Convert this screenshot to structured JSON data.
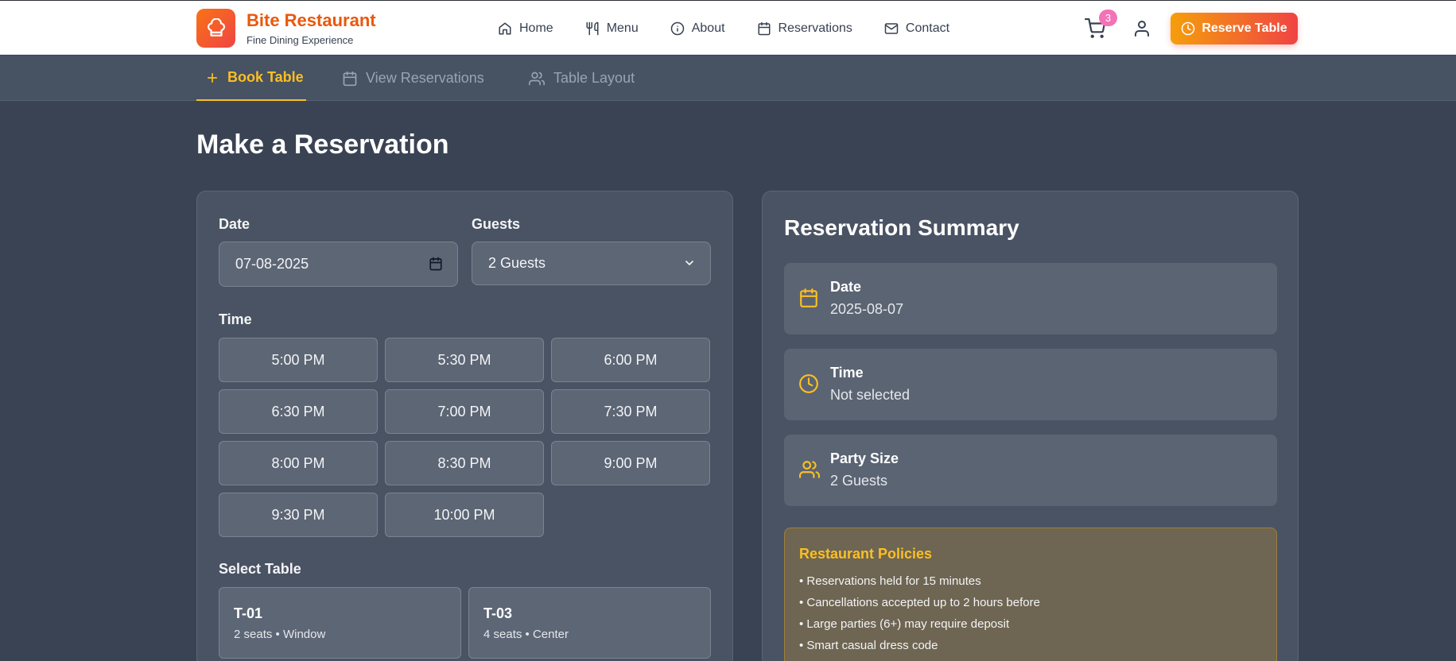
{
  "brand": {
    "name": "Bite Restaurant",
    "tagline": "Fine Dining Experience",
    "logo_icon": "chef-hat-icon"
  },
  "nav": [
    {
      "label": "Home",
      "icon": "home-icon"
    },
    {
      "label": "Menu",
      "icon": "utensils-icon"
    },
    {
      "label": "About",
      "icon": "info-icon"
    },
    {
      "label": "Reservations",
      "icon": "calendar-icon"
    },
    {
      "label": "Contact",
      "icon": "mail-icon"
    }
  ],
  "cart": {
    "count": "3"
  },
  "header_cta": {
    "label": "Reserve Table"
  },
  "tabs": [
    {
      "label": "Book Table",
      "active": true
    },
    {
      "label": "View Reservations",
      "active": false
    },
    {
      "label": "Table Layout",
      "active": false
    }
  ],
  "page_title": "Make a Reservation",
  "form": {
    "date_label": "Date",
    "date_value": "07-08-2025",
    "guests_label": "Guests",
    "guests_value": "2 Guests",
    "time_label": "Time",
    "times": [
      "5:00 PM",
      "5:30 PM",
      "6:00 PM",
      "6:30 PM",
      "7:00 PM",
      "7:30 PM",
      "8:00 PM",
      "8:30 PM",
      "9:00 PM",
      "9:30 PM",
      "10:00 PM"
    ],
    "table_label": "Select Table",
    "tables": [
      {
        "id": "T-01",
        "desc": "2 seats • Window"
      },
      {
        "id": "T-03",
        "desc": "4 seats • Center"
      }
    ]
  },
  "summary": {
    "title": "Reservation Summary",
    "date_key": "Date",
    "date_value": "2025-08-07",
    "time_key": "Time",
    "time_value": "Not selected",
    "party_key": "Party Size",
    "party_value": "2 Guests"
  },
  "policies": {
    "title": "Restaurant Policies",
    "items": [
      "• Reservations held for 15 minutes",
      "• Cancellations accepted up to 2 hours before",
      "• Large parties (6+) may require deposit",
      "• Smart casual dress code"
    ]
  },
  "colors": {
    "accent": "#fbbf24",
    "brand": "#ea580c",
    "background": "#3a4353"
  }
}
